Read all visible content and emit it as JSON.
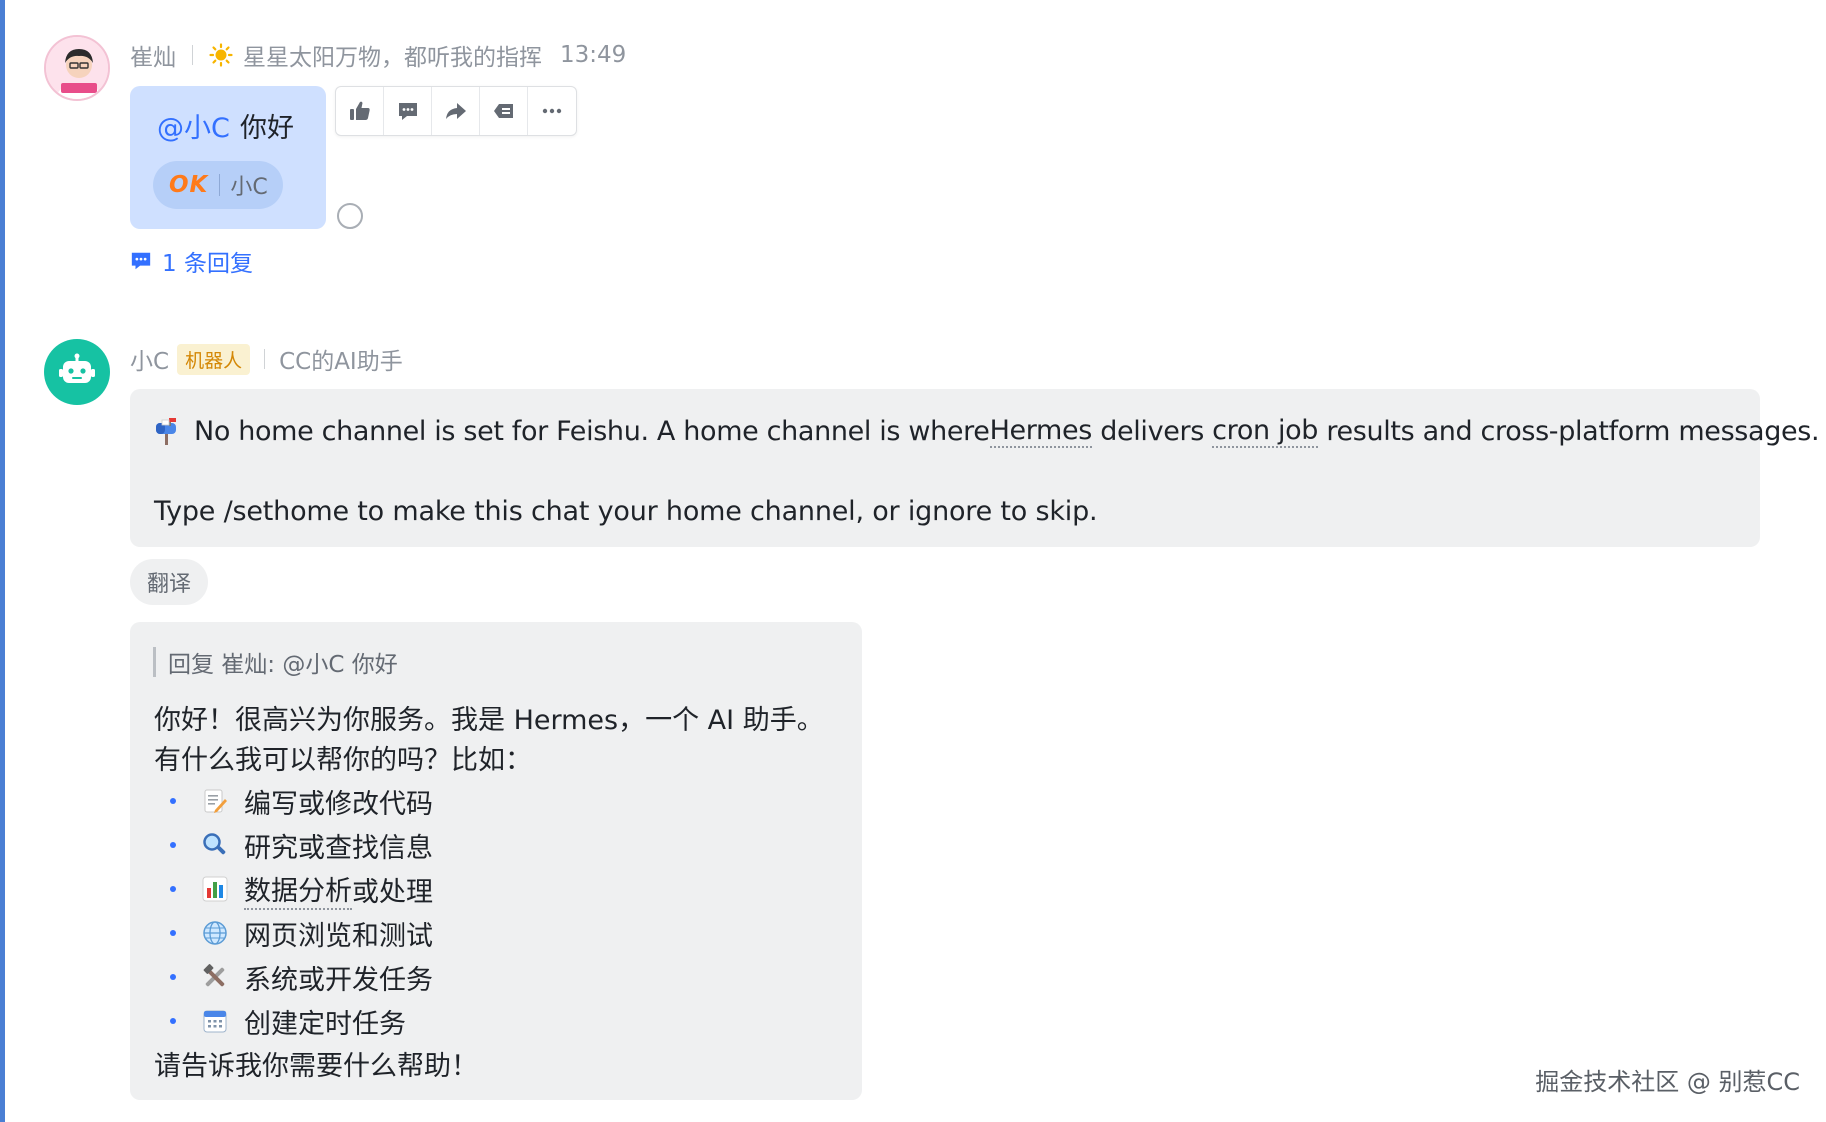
{
  "message1": {
    "sender": "崔灿",
    "status_text": "星星太阳万物，都听我的指挥",
    "time": "13:49",
    "mention": "@小C",
    "text": "你好",
    "reaction": {
      "emoji_text": "OK",
      "user": "小C"
    },
    "reply_count_text": "1 条回复"
  },
  "toolbar": {
    "icons": [
      "thumbs-up-icon",
      "comment-icon",
      "forward-icon",
      "label-icon",
      "more-icon"
    ]
  },
  "message2": {
    "sender": "小C",
    "badge": "机器人",
    "description": "CC的AI助手",
    "notice": {
      "p1_a": "No home channel is set for Feishu. A home channel is where ",
      "p1_term1": "Hermes",
      "p1_b": " delivers ",
      "p1_term2": "cron job",
      "p1_c": " results and cross-platform messages.",
      "p2": "Type /sethome to make this chat your home channel, or ignore to skip."
    },
    "translate_label": "翻译",
    "reply": {
      "quote": "回复 崔灿: @小C 你好",
      "intro_line1": "你好！很高兴为你服务。我是 Hermes，一个 AI 助手。",
      "intro_line2": "有什么我可以帮你的吗？比如：",
      "items": [
        {
          "icon": "memo-icon",
          "text": "编写或修改代码"
        },
        {
          "icon": "magnifier-icon",
          "text": "研究或查找信息"
        },
        {
          "icon": "bar-chart-icon",
          "text_a": "数据分析",
          "text_b": "或处理"
        },
        {
          "icon": "globe-icon",
          "text": "网页浏览和测试"
        },
        {
          "icon": "tools-icon",
          "text": "系统或开发任务"
        },
        {
          "icon": "calendar-icon",
          "text": "创建定时任务"
        }
      ],
      "outro": "请告诉我你需要什么帮助！"
    }
  },
  "watermark": "掘金技术社区 @ 别惹CC",
  "colors": {
    "accent": "#3370ff",
    "user_bubble": "#cfe0ff",
    "bot_bubble": "#eff0f1",
    "bot_avatar": "#16c2a3"
  }
}
